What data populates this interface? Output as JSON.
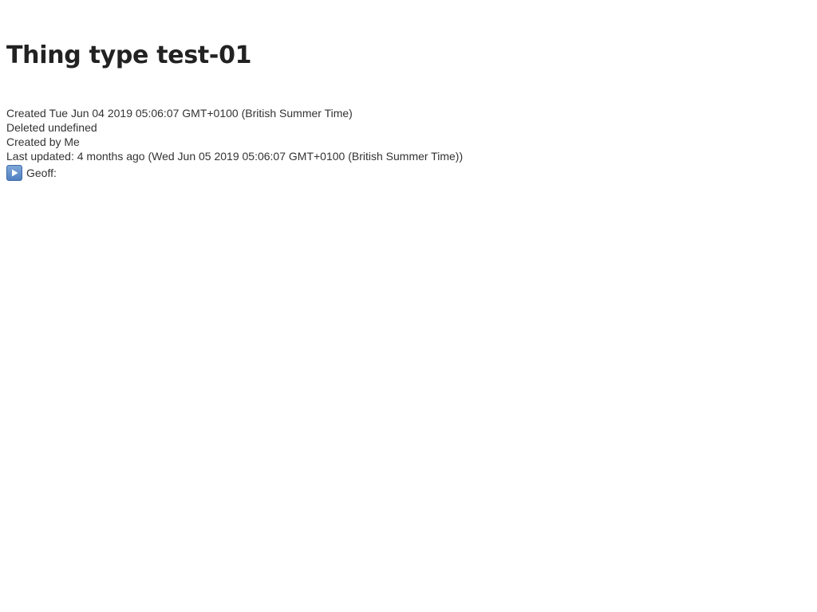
{
  "page": {
    "title": "Thing type test-01"
  },
  "meta": {
    "created": "Created Tue Jun 04 2019 05:06:07 GMT+0100 (British Summer Time)",
    "deleted": "Deleted undefined",
    "created_by": "Created by Me",
    "last_updated": "Last updated: 4 months ago (Wed Jun 05 2019 05:06:07 GMT+0100 (British Summer Time))"
  },
  "expander": {
    "icon": "play-icon",
    "label": "Geoff:",
    "icon_color": "#5b8bd0"
  }
}
